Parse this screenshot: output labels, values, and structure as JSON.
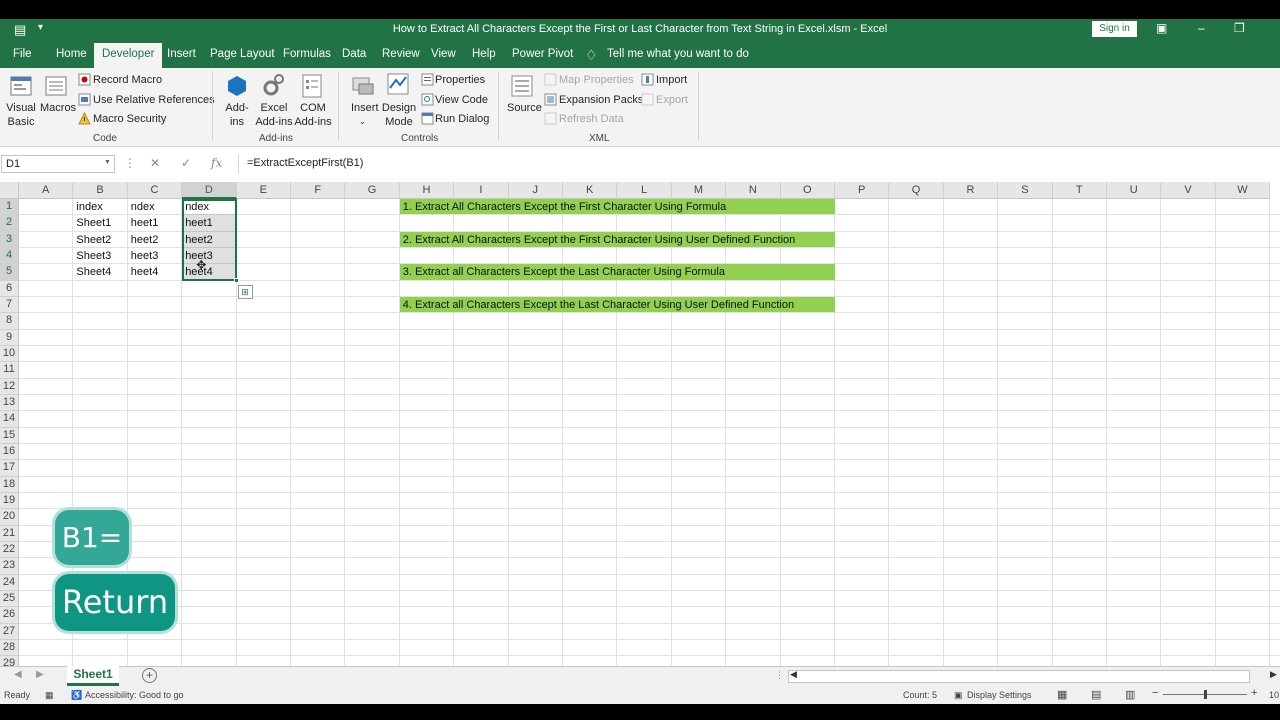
{
  "window": {
    "title": "How to Extract All Characters Except the First or Last Character from Text String in Excel.xlsm  -  Excel",
    "sign_in": "Sign in"
  },
  "tabs": [
    {
      "label": "File"
    },
    {
      "label": "Home"
    },
    {
      "label": "Developer",
      "active": true
    },
    {
      "label": "Insert"
    },
    {
      "label": "Page Layout"
    },
    {
      "label": "Formulas"
    },
    {
      "label": "Data"
    },
    {
      "label": "Review"
    },
    {
      "label": "View"
    },
    {
      "label": "Help"
    },
    {
      "label": "Power Pivot"
    }
  ],
  "tell_me": "Tell me what you want to do",
  "ribbon": {
    "code": {
      "visual_basic": "Visual Basic",
      "macros": "Macros",
      "record_macro": "Record Macro",
      "relative_refs": "Use Relative References",
      "macro_security": "Macro Security",
      "group": "Code"
    },
    "addins": {
      "addins": "Add-ins",
      "excel_addins": "Excel Add-ins",
      "com_addins": "COM Add-ins",
      "group": "Add-ins"
    },
    "controls": {
      "insert": "Insert",
      "design_mode": "Design Mode",
      "properties": "Properties",
      "view_code": "View Code",
      "run_dialog": "Run Dialog",
      "group": "Controls"
    },
    "xml": {
      "source": "Source",
      "map_properties": "Map Properties",
      "expansion_packs": "Expansion Packs",
      "refresh_data": "Refresh Data",
      "import": "Import",
      "export": "Export",
      "group": "XML"
    }
  },
  "formula_bar": {
    "name_box": "D1",
    "formula": "=ExtractExceptFirst(B1)"
  },
  "columns": [
    "A",
    "B",
    "C",
    "D",
    "E",
    "F",
    "G",
    "H",
    "I",
    "J",
    "K",
    "L",
    "M",
    "N",
    "O",
    "P",
    "Q",
    "R",
    "S",
    "T",
    "U",
    "V",
    "W"
  ],
  "rows": [
    "1",
    "2",
    "3",
    "4",
    "5",
    "6",
    "7",
    "8",
    "9",
    "10",
    "11",
    "12",
    "13",
    "14",
    "15",
    "16",
    "17",
    "18",
    "19",
    "20",
    "21",
    "22",
    "23",
    "24",
    "25",
    "26",
    "27",
    "28",
    "29"
  ],
  "cells": {
    "B": [
      "index",
      "Sheet1",
      "Sheet2",
      "Sheet3",
      "Sheet4"
    ],
    "C": [
      "ndex",
      "heet1",
      "heet2",
      "heet3",
      "heet4"
    ],
    "D": [
      "ndex",
      "heet1",
      "heet2",
      "heet3",
      "heet4"
    ]
  },
  "headings": [
    "1. Extract All Characters Except the First Character Using Formula",
    "2. Extract All Characters Except the First Character Using User Defined Function",
    "3. Extract all Characters Except the Last Character Using Formula",
    "4. Extract all Characters Except the Last Character Using User Defined Function"
  ],
  "overlay": {
    "key1": "B1=",
    "key2": "Return"
  },
  "sheet_tabs": [
    "Sheet1"
  ],
  "status": {
    "ready": "Ready",
    "accessibility": "Accessibility: Good to go",
    "count": "Count: 5",
    "display_settings": "Display Settings",
    "zoom": "10"
  },
  "colors": {
    "excel_green": "#217346",
    "heading_fill": "#92d050",
    "overlay_teal": "#0f9584"
  }
}
